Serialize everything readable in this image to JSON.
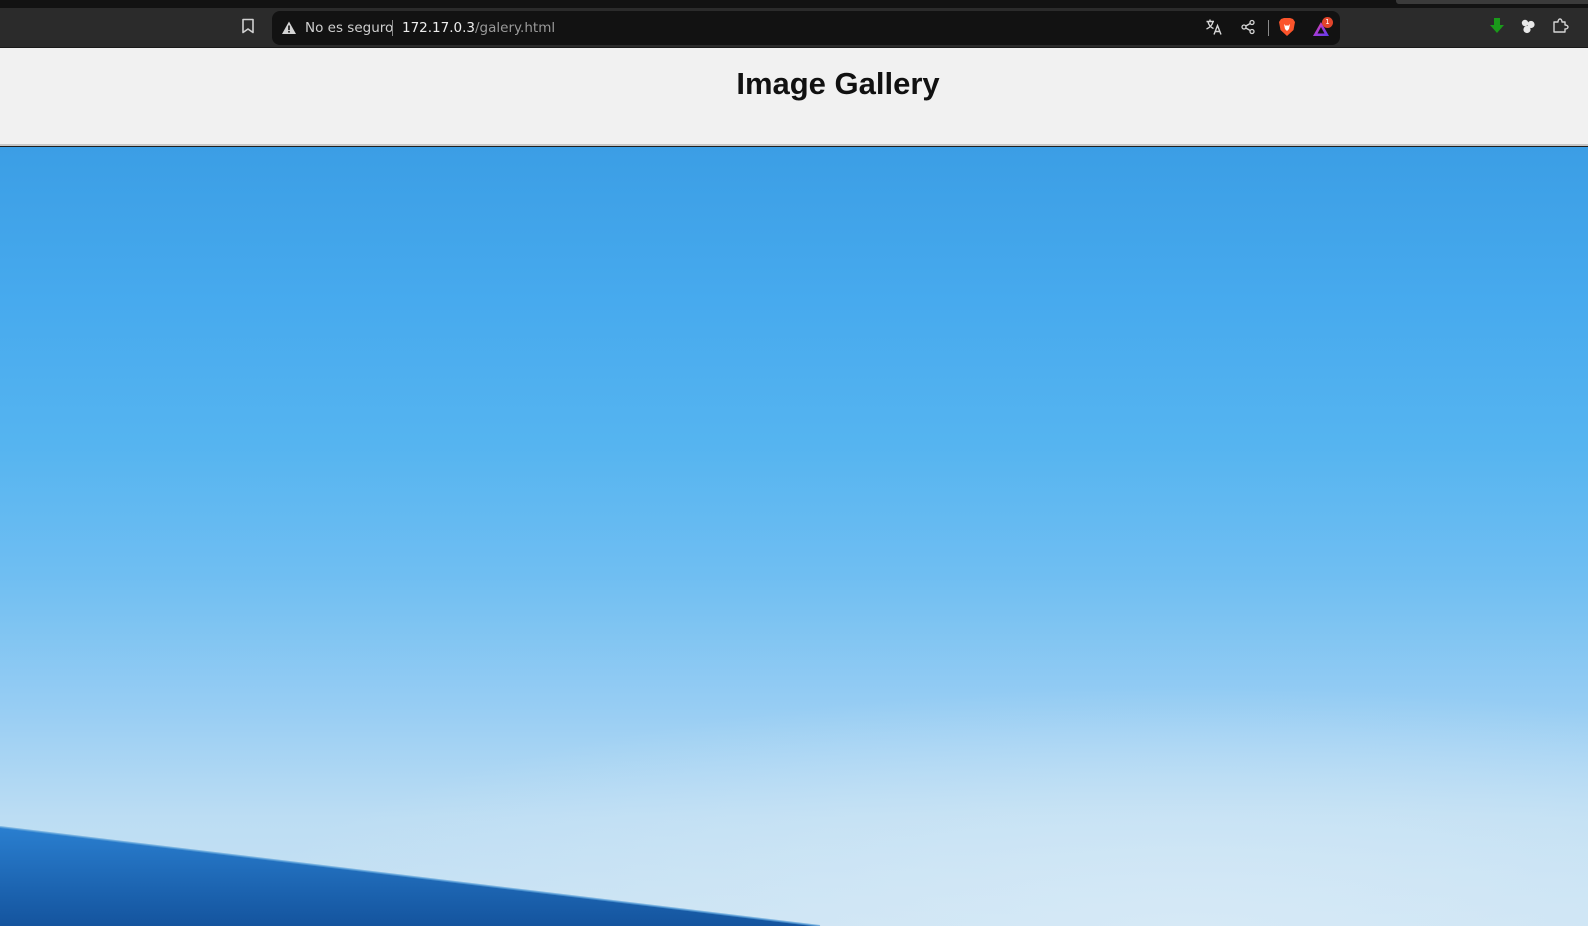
{
  "browser": {
    "security_label": "No es seguro",
    "url_host": "172.17.0.3",
    "url_path": "/galery.html",
    "alerts_badge_count": "1",
    "icons": {
      "bookmark": "bookmark-icon",
      "warning": "warning-triangle-icon",
      "translate": "translate-icon",
      "share": "share-icon",
      "brave_shields": "brave-lion-icon",
      "brave_rewards": "brave-rewards-triangle-icon",
      "download": "download-arrow-icon",
      "extension": "extension-cluster-icon",
      "puzzle": "puzzle-extensions-icon"
    }
  },
  "page": {
    "title": "Image Gallery",
    "image": {
      "description_type": "photo-sky-ocean",
      "colors": {
        "sky_top": "#3b9ee5",
        "sky_bottom": "#c9e2f3",
        "sea": "#1f6fbf"
      }
    }
  },
  "colors": {
    "chrome_bg": "#2b2b2b",
    "omnibox_bg": "#121212",
    "header_bg": "#f1f1f1",
    "download_green": "#1a9a1a",
    "brave_orange": "#fb542b"
  }
}
